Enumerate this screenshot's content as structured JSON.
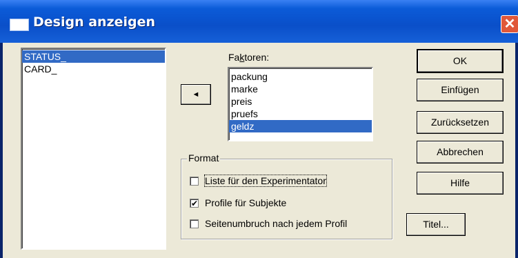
{
  "window": {
    "title": "Design anzeigen",
    "close_glyph": "✕"
  },
  "variables": {
    "items": [
      "STATUS_",
      "CARD_"
    ],
    "selected_index": 0
  },
  "move_button": {
    "glyph": "◄"
  },
  "factors": {
    "label": "Faktoren:",
    "items": [
      "packung",
      "marke",
      "preis",
      "pruefs",
      "geldz"
    ],
    "selected_index": 4
  },
  "format": {
    "caption": "Format",
    "options": [
      {
        "label": "Liste für den Experimentator",
        "checked": false
      },
      {
        "label": "Profile für Subjekte",
        "checked": true
      },
      {
        "label": "Seitenumbruch nach jedem Profil",
        "checked": false
      }
    ]
  },
  "buttons": {
    "ok": "OK",
    "insert": "Einfügen",
    "reset": "Zurücksetzen",
    "cancel": "Abbrechen",
    "help": "Hilfe",
    "titles": "Titel..."
  }
}
